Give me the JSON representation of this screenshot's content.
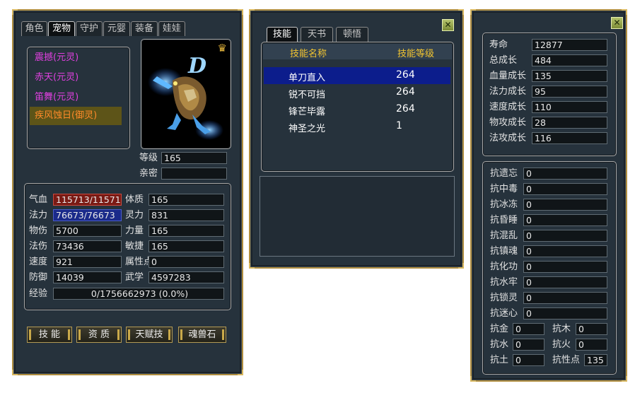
{
  "pet_panel": {
    "tabs": [
      "角色",
      "宠物",
      "守护",
      "元婴",
      "装备",
      "娃娃"
    ],
    "active_tab": 1,
    "pet_list": [
      {
        "name": "震撼(元灵)",
        "selected": false
      },
      {
        "name": "赤天(元灵)",
        "selected": false
      },
      {
        "name": "笛舞(元灵)",
        "selected": false
      },
      {
        "name": "疾风蚀日(御灵)",
        "selected": true
      }
    ],
    "portrait_badge": "D",
    "level_label": "等级",
    "level_value": "165",
    "intimacy_label": "亲密",
    "intimacy_value": "",
    "stats_left": [
      {
        "label": "气血",
        "value": "115713/115713"
      },
      {
        "label": "法力",
        "value": "76673/76673"
      },
      {
        "label": "物伤",
        "value": "5700"
      },
      {
        "label": "法伤",
        "value": "73436"
      },
      {
        "label": "速度",
        "value": "921"
      },
      {
        "label": "防御",
        "value": "14039"
      }
    ],
    "stats_right": [
      {
        "label": "体质",
        "value": "165"
      },
      {
        "label": "灵力",
        "value": "831"
      },
      {
        "label": "力量",
        "value": "165"
      },
      {
        "label": "敏捷",
        "value": "165"
      },
      {
        "label": "属性点",
        "value": "0"
      },
      {
        "label": "武学",
        "value": "4597283"
      }
    ],
    "exp_label": "经验",
    "exp_value": "0/1756662973 (0.0%)",
    "buttons": [
      "技 能",
      "资 质",
      "天赋技",
      "魂兽石"
    ],
    "colors": {
      "hp_bar": "#7a1a14",
      "mp_bar": "#1a2a8a",
      "selected_pet": "#5d5418"
    }
  },
  "skill_panel": {
    "tabs": [
      "技能",
      "天书",
      "顿悟"
    ],
    "active_tab": 0,
    "col_name": "技能名称",
    "col_level": "技能等级",
    "skills": [
      {
        "name": "单刀直入",
        "level": "264",
        "selected": true
      },
      {
        "name": "锐不可挡",
        "level": "264",
        "selected": false
      },
      {
        "name": "锋芒毕露",
        "level": "264",
        "selected": false
      },
      {
        "name": "神圣之光",
        "level": "1",
        "selected": false
      }
    ],
    "close": "✕",
    "colors": {
      "header_text": "#f2c531",
      "selected_row": "#0c1d8c"
    }
  },
  "aptitude_panel": {
    "close": "✕",
    "growth": [
      {
        "label": "寿命",
        "value": "12877"
      },
      {
        "label": "总成长",
        "value": "484"
      },
      {
        "label": "血量成长",
        "value": "135"
      },
      {
        "label": "法力成长",
        "value": "95"
      },
      {
        "label": "速度成长",
        "value": "110"
      },
      {
        "label": "物攻成长",
        "value": "28"
      },
      {
        "label": "法攻成长",
        "value": "116"
      }
    ],
    "resists": [
      {
        "label": "抗遗忘",
        "value": "0"
      },
      {
        "label": "抗中毒",
        "value": "0"
      },
      {
        "label": "抗冰冻",
        "value": "0"
      },
      {
        "label": "抗昏睡",
        "value": "0"
      },
      {
        "label": "抗混乱",
        "value": "0"
      },
      {
        "label": "抗镇魂",
        "value": "0"
      },
      {
        "label": "抗化功",
        "value": "0"
      },
      {
        "label": "抗水牢",
        "value": "0"
      },
      {
        "label": "抗锁灵",
        "value": "0"
      },
      {
        "label": "抗迷心",
        "value": "0"
      }
    ],
    "elements": [
      {
        "label": "抗金",
        "value": "0"
      },
      {
        "label": "抗木",
        "value": "0"
      },
      {
        "label": "抗水",
        "value": "0"
      },
      {
        "label": "抗火",
        "value": "0"
      },
      {
        "label": "抗土",
        "value": "0"
      },
      {
        "label": "抗性点",
        "value": "135"
      }
    ]
  }
}
